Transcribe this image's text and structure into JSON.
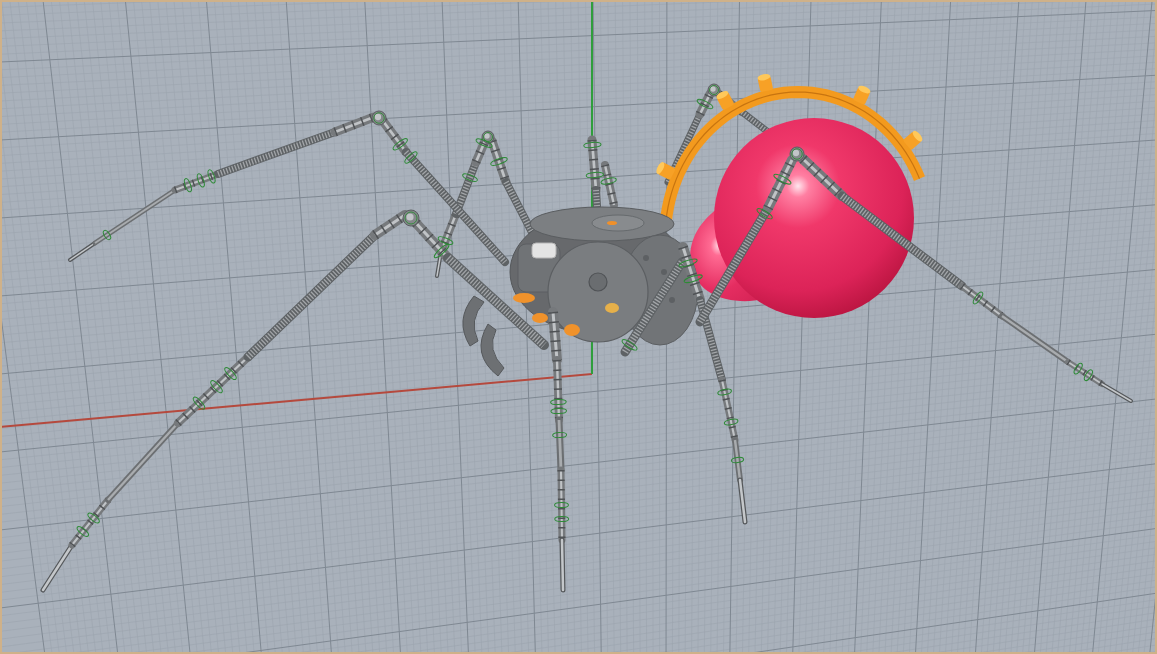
{
  "viewport": {
    "axes": [
      {
        "color": "#b5493d"
      },
      {
        "color": "#2f9e3c"
      }
    ]
  }
}
